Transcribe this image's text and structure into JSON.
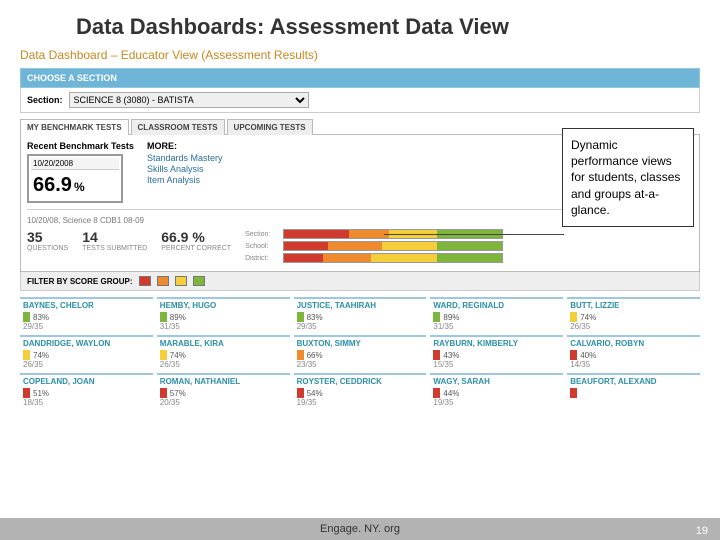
{
  "title": "Data Dashboards: Assessment Data View",
  "subtitle": "Data Dashboard – Educator View (Assessment Results)",
  "choose_label": "CHOOSE A SECTION",
  "section_label": "Section:",
  "section_value": "SCIENCE 8 (3080) - BATISTA",
  "tabs": {
    "t0": "MY BENCHMARK TESTS",
    "t1": "CLASSROOM TESTS",
    "t2": "UPCOMING TESTS"
  },
  "recent": {
    "title": "Recent Benchmark Tests",
    "date": "10/20/2008",
    "score": "66.9",
    "pct": "%"
  },
  "more": {
    "hdr": "MORE:",
    "l0": "Standards Mastery",
    "l1": "Skills Analysis",
    "l2": "Item Analysis"
  },
  "meta_line": "10/20/08, Science 8 CDB1 08-09",
  "stats": {
    "q_v": "35",
    "q_l": "QUESTIONS",
    "s_v": "14",
    "s_l": "TESTS SUBMITTED",
    "p_v": "66.9 %",
    "p_l": "PERCENT CORRECT"
  },
  "bar_labels": {
    "r0": "Section:",
    "r1": "School:",
    "r2": "District:"
  },
  "filter_label": "FILTER BY SCORE GROUP:",
  "students": [
    [
      {
        "name": "BAYNES, CHELOR",
        "pct": "83%",
        "frac": "29/35",
        "c": "green"
      },
      {
        "name": "HEMBY, HUGO",
        "pct": "89%",
        "frac": "31/35",
        "c": "green"
      },
      {
        "name": "JUSTICE, TAAHIRAH",
        "pct": "83%",
        "frac": "29/35",
        "c": "green"
      },
      {
        "name": "WARD, REGINALD",
        "pct": "89%",
        "frac": "31/35",
        "c": "green"
      },
      {
        "name": "BUTT, LIZZIE",
        "pct": "74%",
        "frac": "26/35",
        "c": "yellow"
      }
    ],
    [
      {
        "name": "DANDRIDGE, WAYLON",
        "pct": "74%",
        "frac": "26/35",
        "c": "yellow"
      },
      {
        "name": "MARABLE, KIRA",
        "pct": "74%",
        "frac": "26/35",
        "c": "yellow"
      },
      {
        "name": "BUXTON, SIMMY",
        "pct": "66%",
        "frac": "23/35",
        "c": "orange"
      },
      {
        "name": "RAYBURN, KIMBERLY",
        "pct": "43%",
        "frac": "15/35",
        "c": "red"
      },
      {
        "name": "CALVARIO, ROBYN",
        "pct": "40%",
        "frac": "14/35",
        "c": "red"
      }
    ],
    [
      {
        "name": "COPELAND, JOAN",
        "pct": "51%",
        "frac": "18/35",
        "c": "red"
      },
      {
        "name": "ROMAN, NATHANIEL",
        "pct": "57%",
        "frac": "20/35",
        "c": "red"
      },
      {
        "name": "ROYSTER, CEDDRICK",
        "pct": "54%",
        "frac": "19/35",
        "c": "red"
      },
      {
        "name": "WAGY, SARAH",
        "pct": "44%",
        "frac": "19/35",
        "c": "red"
      },
      {
        "name": "BEAUFORT, ALEXAND",
        "pct": "",
        "frac": "",
        "c": "red"
      }
    ]
  ],
  "callout": "Dynamic performance views for students, classes and groups at-a-glance.",
  "footer": "Engage. NY. org",
  "page": "19",
  "chart_data": {
    "type": "bar",
    "title": "Score group distribution",
    "series_labels": [
      "red",
      "orange",
      "yellow",
      "green"
    ],
    "rows": [
      {
        "label": "Section",
        "values": [
          30,
          18,
          22,
          30
        ]
      },
      {
        "label": "School",
        "values": [
          20,
          25,
          25,
          30
        ]
      },
      {
        "label": "District",
        "values": [
          18,
          22,
          30,
          30
        ]
      }
    ]
  }
}
